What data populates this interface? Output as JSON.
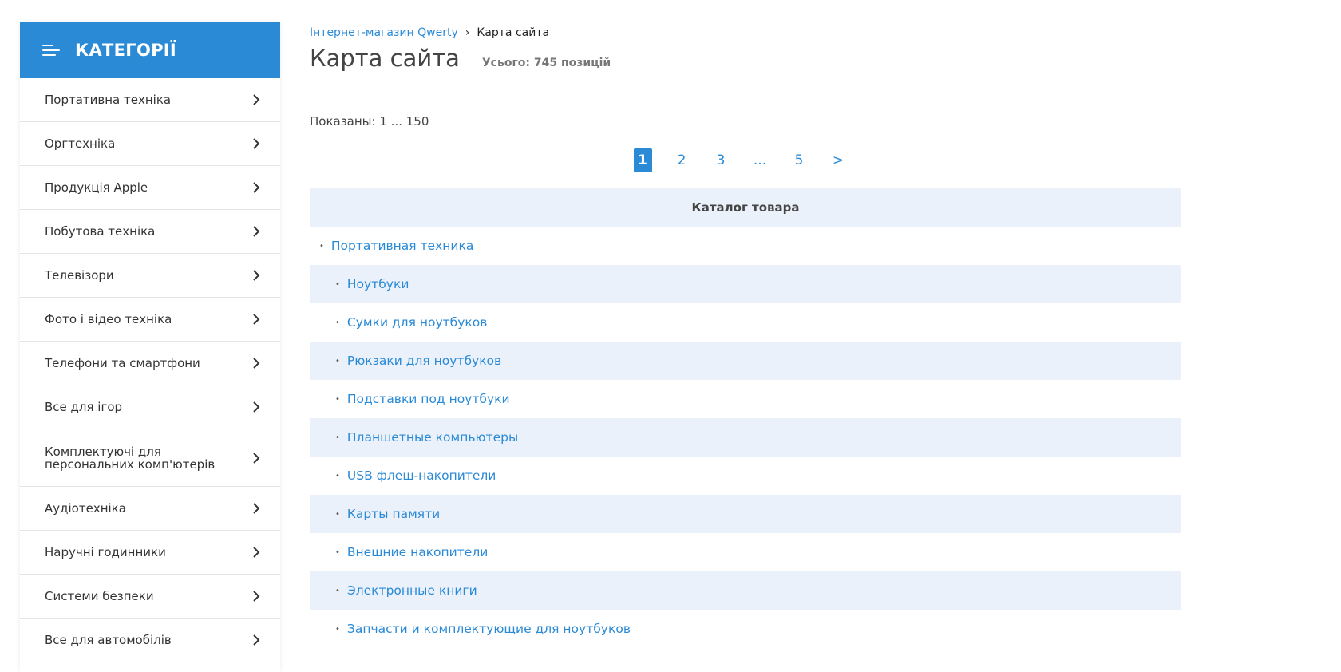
{
  "sidebar": {
    "title": "КАТЕГОРІЇ",
    "items": [
      {
        "label": "Портативна техніка"
      },
      {
        "label": "Оргтехніка"
      },
      {
        "label": "Продукція Apple"
      },
      {
        "label": "Побутова техніка"
      },
      {
        "label": "Телевізори"
      },
      {
        "label": "Фото і відео техніка"
      },
      {
        "label": "Телефони та смартфони"
      },
      {
        "label": "Все для ігор"
      },
      {
        "label": "Комплектуючі для персональних комп'ютерів"
      },
      {
        "label": "Аудіотехніка"
      },
      {
        "label": "Наручні годинники"
      },
      {
        "label": "Системи безпеки"
      },
      {
        "label": "Все для автомобілів"
      }
    ]
  },
  "breadcrumb": {
    "home": "Інтернет-магазин Qwerty",
    "current": "Карта сайта"
  },
  "page": {
    "title": "Карта сайта",
    "total": "Усього: 745 позицій",
    "shown": "Показаны: 1 ... 150"
  },
  "pagination": {
    "pages": [
      "1",
      "2",
      "3",
      "...",
      "5",
      ">"
    ],
    "active": "1"
  },
  "catalog": {
    "header": "Каталог товара",
    "rows": [
      {
        "label": "Портативная техника",
        "level": 0
      },
      {
        "label": "Ноутбуки",
        "level": 1
      },
      {
        "label": "Сумки для ноутбуков",
        "level": 1
      },
      {
        "label": "Рюкзаки для ноутбуков",
        "level": 1
      },
      {
        "label": "Подставки под ноутбуки",
        "level": 1
      },
      {
        "label": "Планшетные компьютеры",
        "level": 1
      },
      {
        "label": "USB флеш-накопители",
        "level": 1
      },
      {
        "label": "Карты памяти",
        "level": 1
      },
      {
        "label": "Внешние накопители",
        "level": 1
      },
      {
        "label": "Электронные книги",
        "level": 1
      },
      {
        "label": "Запчасти и комплектующие для ноутбуков",
        "level": 1
      }
    ]
  },
  "colors": {
    "accent": "#2b8ad6",
    "row_alt": "#eaf1fa"
  }
}
